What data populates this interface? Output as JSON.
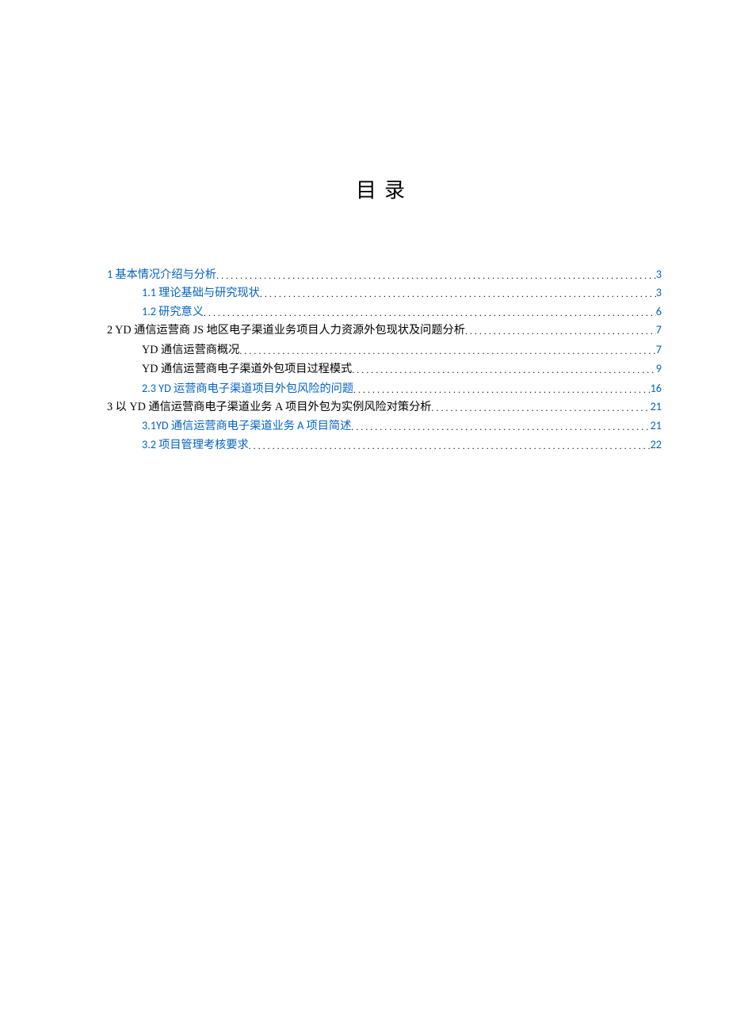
{
  "title": "目录",
  "toc": [
    {
      "level": 1,
      "label": "1  基本情况介绍与分析",
      "page": "3",
      "link": true
    },
    {
      "level": 2,
      "label": "1.1 理论基础与研究现状",
      "page": "3",
      "link": true
    },
    {
      "level": 2,
      "label": "1.2  研究意义",
      "page": "6",
      "link": true
    },
    {
      "level": 1,
      "label": "2 YD 通信运营商 JS 地区电子渠道业务项目人力资源外包现状及问题分析",
      "page": "7",
      "link": false
    },
    {
      "level": 2,
      "label": "YD 通信运营商概况",
      "page": "7",
      "link": false
    },
    {
      "level": 2,
      "label": "YD 通信运营商电子渠道外包项目过程模式",
      "page": "9",
      "link": false
    },
    {
      "level": 2,
      "label": "2.3 YD 运营商电子渠道项目外包风险的问题",
      "page": "16",
      "link": true
    },
    {
      "level": 1,
      "label": "3 以 YD 通信运营商电子渠道业务 A 项目外包为实例风险对策分析 ",
      "page": "21",
      "link": false
    },
    {
      "level": 2,
      "label": "3.1YD 通信运营商电子渠道业务 A 项目简述",
      "page": "21",
      "link": true
    },
    {
      "level": 2,
      "label": "3.2 项目管理考核要求",
      "page": "22",
      "link": true
    }
  ]
}
